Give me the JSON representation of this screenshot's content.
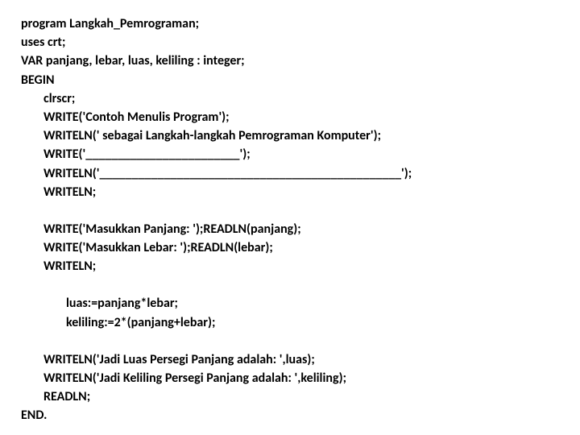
{
  "code": {
    "l1": "program Langkah_Pemrograman;",
    "l2": "uses crt;",
    "l3": "VAR panjang, lebar, luas, keliling : integer;",
    "l4": "BEGIN",
    "l5": "clrscr;",
    "l6": "WRITE('Contoh Menulis Program');",
    "l7": "WRITELN(' sebagai Langkah-langkah Pemrograman Komputer');",
    "l8": "WRITE('________________________');",
    "l9": "WRITELN('_______________________________________________');",
    "l10": "WRITELN;",
    "l11": "WRITE('Masukkan Panjang: ');READLN(panjang);",
    "l12": "WRITE('Masukkan Lebar: ');READLN(lebar);",
    "l13": "WRITELN;",
    "l14": "luas:=panjang*lebar;",
    "l15": "keliling:=2*(panjang+lebar);",
    "l16": "WRITELN('Jadi Luas Persegi Panjang adalah: ',luas);",
    "l17": "WRITELN('Jadi Keliling Persegi Panjang adalah: ',keliling);",
    "l18": "READLN;",
    "l19": "END."
  }
}
